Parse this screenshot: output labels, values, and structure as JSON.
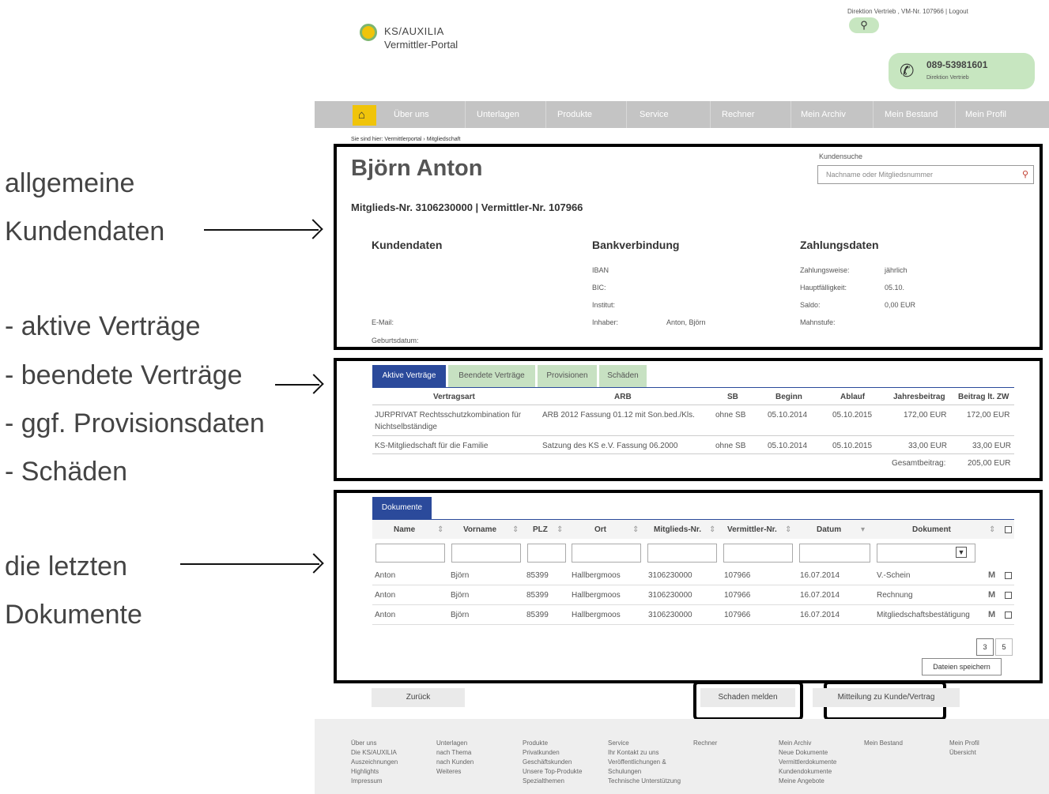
{
  "annotations": {
    "general_line1": "allgemeine",
    "general_line2": "Kundendaten",
    "contracts": [
      "- aktive Verträge",
      "- beendete Verträge",
      "- ggf. Provisionsdaten",
      "- Schäden"
    ],
    "docs_line1": "die letzten",
    "docs_line2": "Dokumente"
  },
  "header": {
    "logo_name": "KS/AUXILIA",
    "portal_name": "Vermittler-Portal",
    "top_links": "Direktion Vertrieb , VM-Nr. 107966 | Logout",
    "phone": "089-53981601",
    "phone_sub": "Direktion Vertrieb"
  },
  "nav": {
    "items": [
      "Über uns",
      "Unterlagen",
      "Produkte",
      "Service",
      "Rechner",
      "Mein Archiv",
      "Mein Bestand",
      "Mein Profil"
    ]
  },
  "breadcrumb": "Sie sind hier: Vermittlerportal › Mitgliedschaft",
  "customer": {
    "name": "Björn Anton",
    "ids": "Mitglieds-Nr. 3106230000 | Vermittler-Nr. 107966",
    "search_label": "Kundensuche",
    "search_placeholder": "Nachname oder Mitgliedsnummer",
    "kundendaten_title": "Kundendaten",
    "email_label": "E-Mail:",
    "birth_label": "Geburtsdatum:",
    "bank_title": "Bankverbindung",
    "iban_label": "IBAN",
    "bic_label": "BIC:",
    "institut_label": "Institut:",
    "inhaber_label": "Inhaber:",
    "inhaber_value": "Anton, Björn",
    "pay_title": "Zahlungsdaten",
    "zahlungsweise_label": "Zahlungsweise:",
    "zahlungsweise_value": "jährlich",
    "faelligkeit_label": "Hauptfälligkeit:",
    "faelligkeit_value": "05.10.",
    "saldo_label": "Saldo:",
    "saldo_value": "0,00 EUR",
    "mahn_label": "Mahnstufe:"
  },
  "contracts": {
    "tabs": [
      "Aktive Verträge",
      "Beendete Verträge",
      "Provisionen",
      "Schäden"
    ],
    "headers": [
      "Vertragsart",
      "ARB",
      "SB",
      "Beginn",
      "Ablauf",
      "Jahresbeitrag",
      "Beitrag lt. ZW"
    ],
    "rows": [
      {
        "art": "JURPRIVAT Rechtsschutzkombination für",
        "art2": "Nichtselbständige",
        "arb": "ARB 2012 Fassung 01.12 mit Son.bed./Kls.",
        "sb": "ohne SB",
        "beginn": "05.10.2014",
        "ablauf": "05.10.2015",
        "jahr": "172,00 EUR",
        "zw": "172,00 EUR"
      },
      {
        "art": "KS-Mitgliedschaft für die Familie",
        "art2": "",
        "arb": "Satzung des KS e.V. Fassung 06.2000",
        "sb": "ohne SB",
        "beginn": "05.10.2014",
        "ablauf": "05.10.2015",
        "jahr": "33,00 EUR",
        "zw": "33,00 EUR"
      }
    ],
    "total_label": "Gesamtbeitrag:",
    "total_value": "205,00 EUR"
  },
  "documents": {
    "tab": "Dokumente",
    "headers": [
      "Name",
      "Vorname",
      "PLZ",
      "Ort",
      "Mitglieds-Nr.",
      "Vermittler-Nr.",
      "Datum",
      "Dokument"
    ],
    "rows": [
      {
        "name": "Anton",
        "vorname": "Björn",
        "plz": "85399",
        "ort": "Hallbergmoos",
        "mnr": "3106230000",
        "vnr": "107966",
        "datum": "16.07.2014",
        "dok": "V.-Schein"
      },
      {
        "name": "Anton",
        "vorname": "Björn",
        "plz": "85399",
        "ort": "Hallbergmoos",
        "mnr": "3106230000",
        "vnr": "107966",
        "datum": "16.07.2014",
        "dok": "Rechnung"
      },
      {
        "name": "Anton",
        "vorname": "Björn",
        "plz": "85399",
        "ort": "Hallbergmoos",
        "mnr": "3106230000",
        "vnr": "107966",
        "datum": "16.07.2014",
        "dok": "Mitgliedschaftsbestätigung"
      }
    ],
    "pages": [
      "3",
      "5"
    ],
    "save_button": "Dateien speichern"
  },
  "actions": {
    "back": "Zurück",
    "damage": "Schaden melden",
    "message": "Mitteilung zu Kunde/Vertrag"
  },
  "footer": {
    "col1": "Über uns\nDie KS/AUXILIA\nAuszeichnungen\nHighlights\nImpressum",
    "col2": "Unterlagen\nnach Thema\nnach Kunden\nWeiteres",
    "col3": "Produkte\nPrivatkunden\nGeschäftskunden\nUnsere Top-Produkte\nSpezialthemen",
    "col4": "Service\nIhr Kontakt zu uns\nVeröffentlichungen &\nSchulungen\nTechnische Unterstützung",
    "col5": "Rechner",
    "col6": "Mein Archiv\nNeue Dokumente\nVermittlerdokumente\nKundendokumente\nMeine Angebote",
    "col7": "Mein Bestand",
    "col8": "Mein Profil\nÜbersicht"
  },
  "colors": {
    "nav_bg": "#c4c4c4",
    "home_icon": "#f0c40a",
    "tab_active": "#2b4a9b",
    "tab_inactive": "#c7e1c2",
    "phone_box": "#c7e6c0"
  }
}
